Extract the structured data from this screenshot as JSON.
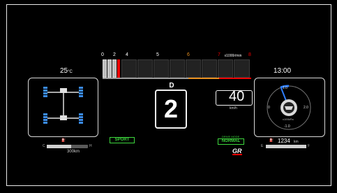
{
  "tachometer": {
    "ticks": [
      "0",
      "2",
      "4",
      "5",
      "6",
      "7",
      "8"
    ],
    "unit": "x1000r/min"
  },
  "temperature": {
    "value": "25",
    "unit": "°C"
  },
  "clock": {
    "time": "13:00"
  },
  "gear": {
    "mode": "D",
    "current": "2"
  },
  "speed": {
    "value": "40",
    "unit": "km/h"
  },
  "drive_modes": {
    "sport": "SPORT",
    "normal": "NORMAL",
    "normal_top": "DRIVE MODE"
  },
  "fuel": {
    "range": "300km",
    "low_label": "C",
    "high_label": "H"
  },
  "odometer": {
    "value": "1234",
    "unit": "km",
    "left_label": "E",
    "right_label": "F"
  },
  "boost_gauge": {
    "labels": [
      "-1.0",
      "0",
      "1.0",
      "2.0",
      "x100kPa"
    ]
  },
  "brand": {
    "logo": "GR"
  },
  "colors": {
    "accent_green": "#3dd63d",
    "redline": "#e00000",
    "tire_blue": "#3a8be8",
    "gauge_needle": "#2e7fff"
  }
}
